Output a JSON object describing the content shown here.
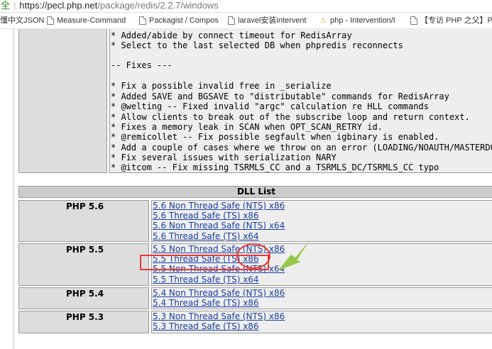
{
  "address_bar": {
    "security": "全",
    "host": "https://pecl.php.net",
    "path": "/package/redis/2.2.7/windows"
  },
  "bookmarks": [
    "懂中文JSON",
    "Measure-Command",
    "Packagist / Compos",
    "laravel安装intervent",
    "php - Intervention/I",
    "【专访 PHP 之父】PH"
  ],
  "notes": [
    "* Added/abide by connect timeout for RedisArray",
    "* Select to the last selected DB when phpredis reconnects",
    "",
    "-- Fixes ---",
    "",
    "* Fix a possible invalid free in _serialize",
    "* Added SAVE and BGSAVE to \"distributable\" commands for RedisArray",
    "* @welting -- Fixed invalid \"argc\" calculation re HLL commands",
    "* Allow clients to break out of the subscribe loop and return context.",
    "* Fixes a memory leak in SCAN when OPT_SCAN_RETRY id.",
    "* @remicollet -- Fix possible segfault when igbinary is enabled.",
    "* Add a couple of cases where we throw on an error (LOADING/NOAUTH/MASTERDOWN)",
    "* Fix several issues with serialization NARY",
    "* @itcom -- Fix missing TSRMLS_CC and a TSRMLS_DC/TSRMLS_CC typo"
  ],
  "dll_list": {
    "title": "DLL List",
    "versions": [
      {
        "version": "PHP 5.6",
        "links": [
          "5.6 Non Thread Safe (NTS) x86",
          "5.6 Thread Safe (TS) x86",
          "5.6 Non Thread Safe (NTS) x64",
          "5.6 Thread Safe (TS) x64"
        ]
      },
      {
        "version": "PHP 5.5",
        "links": [
          "5.5 Non Thread Safe (NTS) x86",
          "5.5 Thread Safe (TS) x86",
          "5.5 Non Thread Safe (NTS) x64",
          "5.5 Thread Safe (TS) x64"
        ]
      },
      {
        "version": "PHP 5.4",
        "links": [
          "5.4 Non Thread Safe (NTS) x86",
          "5.4 Thread Safe (TS) x86"
        ]
      },
      {
        "version": "PHP 5.3",
        "links": [
          "5.3 Non Thread Safe (NTS) x86",
          "5.3 Thread Safe (TS) x86"
        ]
      }
    ]
  },
  "colors": {
    "link": "#1a3ea0",
    "annotation_red": "#e53935",
    "annotation_green": "#8dc63f"
  }
}
